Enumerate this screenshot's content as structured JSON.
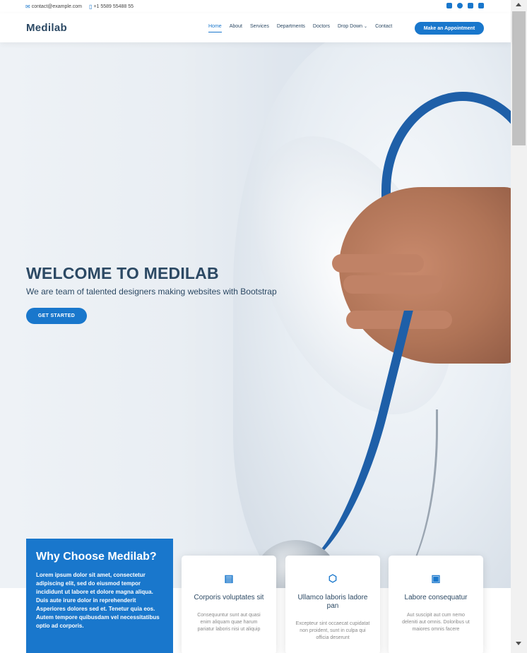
{
  "topbar": {
    "email": "contact@example.com",
    "phone": "+1 5589 55488 55",
    "email_icon": "envelope-icon",
    "phone_icon": "phone-icon",
    "social_icons": [
      "twitter-icon",
      "facebook-icon",
      "instagram-icon",
      "linkedin-icon"
    ]
  },
  "header": {
    "logo": "Medilab",
    "nav": [
      "Home",
      "About",
      "Services",
      "Departments",
      "Doctors",
      "Drop Down",
      "Contact"
    ],
    "active_item": "Home",
    "appointment_label": "Make an Appointment"
  },
  "hero": {
    "title": "WELCOME TO MEDILAB",
    "subtitle": "We are team of talented designers making websites with Bootstrap",
    "cta_label": "GET STARTED"
  },
  "why": {
    "title": "Why Choose Medilab?",
    "text": "Lorem ipsum dolor sit amet, consectetur adipiscing elit, sed do eiusmod tempor incididunt ut labore et dolore magna aliqua. Duis aute irure dolor in reprehenderit Asperiores dolores sed et. Tenetur quia eos. Autem tempore quibusdam vel necessitatibus optio ad corporis."
  },
  "cards": [
    {
      "icon": "receipt-icon",
      "title": "Corporis voluptates sit",
      "text": "Consequuntur sunt aut quasi enim aliquam quae harum pariatur laboris nisi ut aliquip"
    },
    {
      "icon": "cube-icon",
      "title": "Ullamco laboris ladore pan",
      "text": "Excepteur sint occaecat cupidatat non proident, sunt in culpa qui officia deserunt"
    },
    {
      "icon": "images-icon",
      "title": "Labore consequatur",
      "text": "Aut suscipit aut cum nemo deleniti aut omnis. Doloribus ut maiores omnis facere"
    }
  ],
  "colors": {
    "accent": "#1977cc",
    "heading": "#2c4964"
  }
}
